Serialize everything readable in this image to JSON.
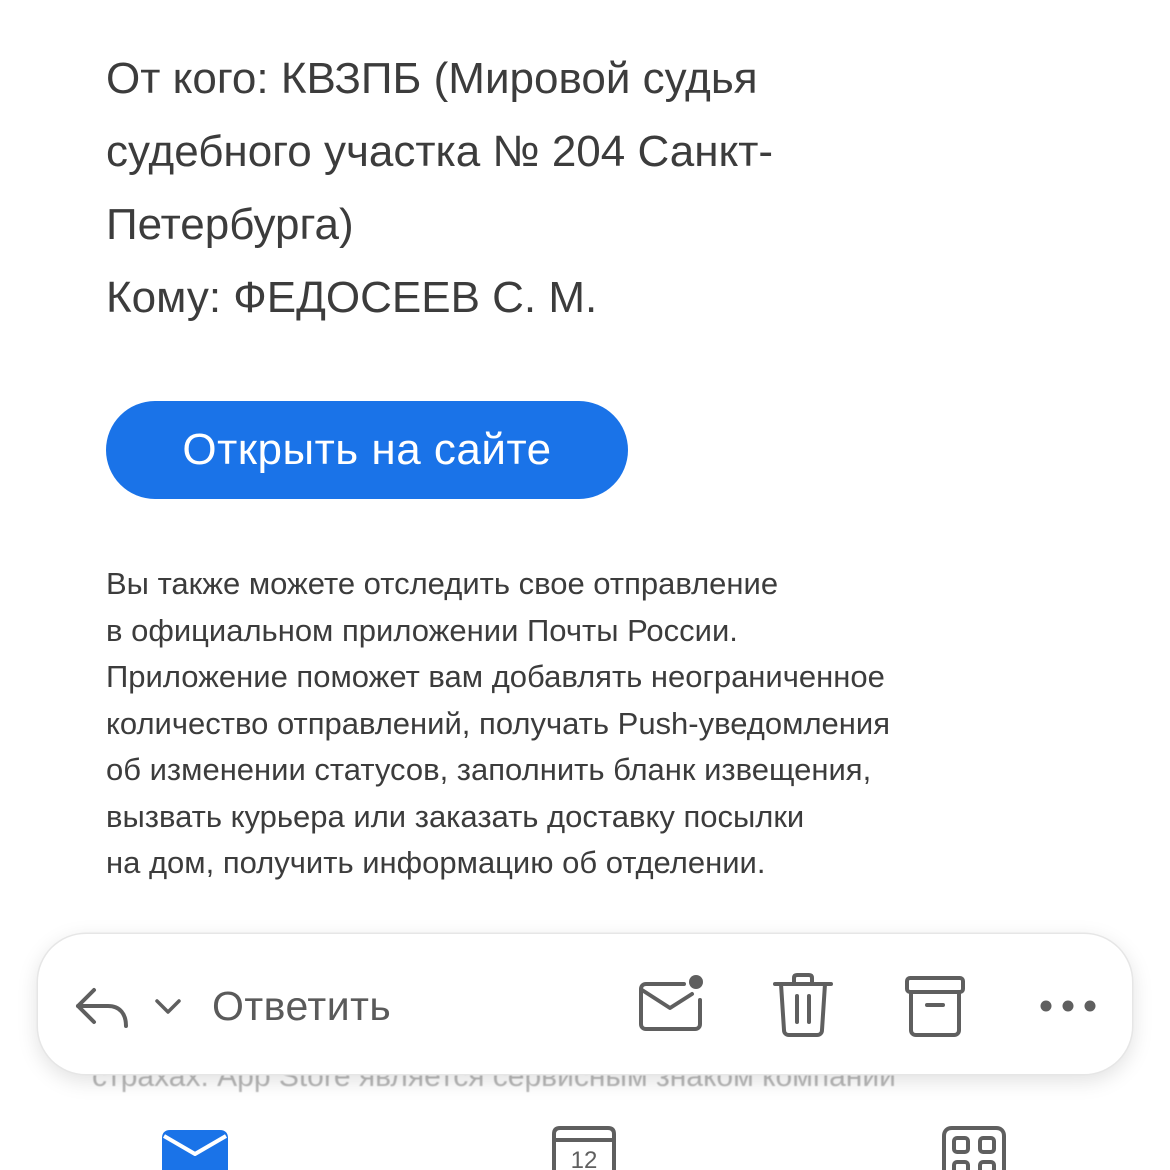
{
  "message": {
    "from_line_1": "От кого: КВЗПБ (Мировой судья",
    "from_line_2": "судебного участка № 204 Санкт-",
    "from_line_3": "Петербурга)",
    "to_line": "Кому: ФЕДОСЕЕВ С. М.",
    "open_button_label": "Открыть на сайте",
    "info_lines": [
      "Вы также можете отследить свое отправление",
      "в официальном приложении Почты России.",
      "Приложение поможет вам добавлять неограниченное",
      "количество отправлений, получать Push-уведомления",
      "об изменении статусов, заполнить бланк извещения,",
      "вызвать курьера или заказать доставку посылки",
      "на дом, получить информацию об отделении."
    ],
    "partially_hidden_text": "страхах. App Store является сервисным знаком компании"
  },
  "toolbar": {
    "reply_label": "Ответить",
    "icons": {
      "reply": "reply-icon",
      "reply_options": "chevron-down-icon",
      "mark_unread": "mail-unread-icon",
      "delete": "trash-icon",
      "archive": "archive-icon",
      "more": "more-icon"
    }
  },
  "bottom_nav": {
    "calendar_day": "12",
    "icons": {
      "mail": "mail-tab-icon",
      "calendar": "calendar-tab-icon",
      "apps": "apps-tab-icon"
    }
  },
  "colors": {
    "accent": "#1a73e8",
    "text_primary": "#3c3c3c",
    "icon_gray": "#5f5f5f",
    "unread_dot": "#5f5f5f"
  }
}
